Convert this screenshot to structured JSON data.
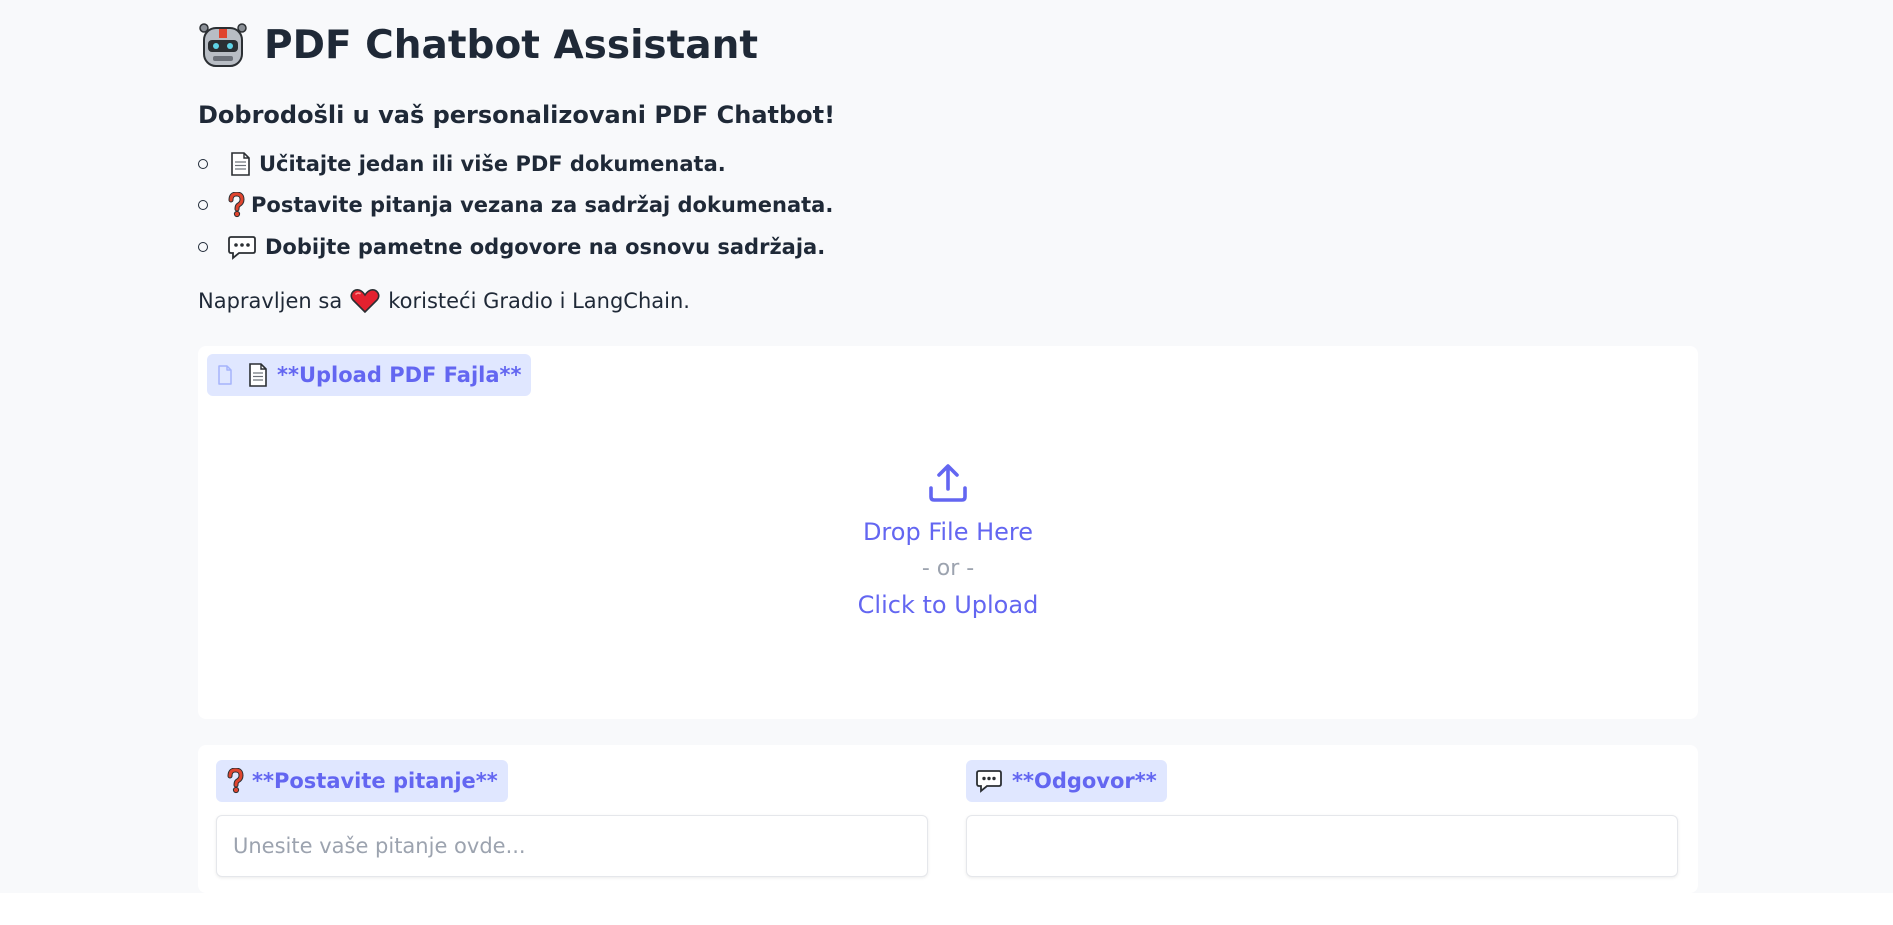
{
  "header": {
    "title": "PDF Chatbot Assistant",
    "icon": "robot-icon"
  },
  "intro": {
    "welcome": "Dobrodošli u vaš personalizovani PDF Chatbot!",
    "bullets": [
      {
        "icon": "page-emoji-icon",
        "text": "Učitajte jedan ili više PDF dokumenata."
      },
      {
        "icon": "question-mark-emoji-icon",
        "text": "Postavite pitanja vezana za sadržaj dokumenata."
      },
      {
        "icon": "speech-bubble-emoji-icon",
        "text": "Dobijte pametne odgovore na osnovu sadržaja."
      }
    ],
    "made_with_prefix": "Napravljen sa",
    "made_with_suffix": "koristeći Gradio i LangChain."
  },
  "upload": {
    "label": "**Upload PDF Fajla**",
    "drop_text": "Drop File Here",
    "or_text": "- or -",
    "click_text": "Click to Upload"
  },
  "question": {
    "label": "**Postavite pitanje**",
    "placeholder": "Unesite vaše pitanje ovde...",
    "value": ""
  },
  "answer": {
    "label": "**Odgovor**",
    "value": ""
  },
  "colors": {
    "accent": "#6366f1",
    "label_bg": "#e0e7ff",
    "page_bg": "#f8f9fb",
    "text": "#1f2937",
    "muted": "#9ca3af"
  }
}
